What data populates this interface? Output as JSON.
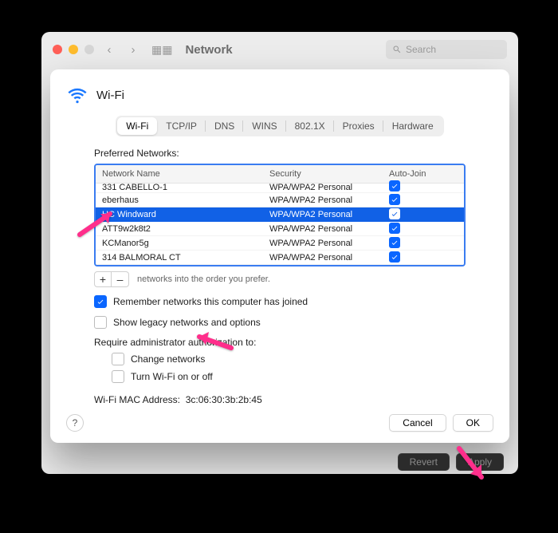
{
  "window": {
    "title": "Network",
    "search_placeholder": "Search"
  },
  "sheet": {
    "title": "Wi-Fi",
    "tabs": [
      "Wi-Fi",
      "TCP/IP",
      "DNS",
      "WINS",
      "802.1X",
      "Proxies",
      "Hardware"
    ],
    "active_tab": 0,
    "preferred_label": "Preferred Networks:",
    "columns": {
      "name": "Network Name",
      "security": "Security",
      "auto": "Auto-Join"
    },
    "rows": [
      {
        "name": "331 CABELLO-1",
        "security": "WPA/WPA2 Personal",
        "auto": true,
        "selected": false,
        "clipped": true
      },
      {
        "name": "eberhaus",
        "security": "WPA/WPA2 Personal",
        "auto": true,
        "selected": false
      },
      {
        "name": "HC Windward",
        "security": "WPA/WPA2 Personal",
        "auto": true,
        "selected": true
      },
      {
        "name": "ATT9w2k8t2",
        "security": "WPA/WPA2 Personal",
        "auto": true,
        "selected": false
      },
      {
        "name": "KCManor5g",
        "security": "WPA/WPA2 Personal",
        "auto": true,
        "selected": false
      },
      {
        "name": "314 BALMORAL CT",
        "security": "WPA/WPA2 Personal",
        "auto": true,
        "selected": false
      }
    ],
    "add_label": "+",
    "remove_label": "–",
    "drag_hint_suffix": "networks into the order you prefer.",
    "remember_label": "Remember networks this computer has joined",
    "legacy_label": "Show legacy networks and options",
    "require_label": "Require administrator authorization to:",
    "change_label": "Change networks",
    "turnoff_label": "Turn Wi-Fi on or off",
    "mac_label": "Wi-Fi MAC Address:",
    "mac_value": "3c:06:30:3b:2b:45",
    "help": "?",
    "cancel": "Cancel",
    "ok": "OK"
  },
  "bottom": {
    "revert": "Revert",
    "apply": "Apply"
  }
}
